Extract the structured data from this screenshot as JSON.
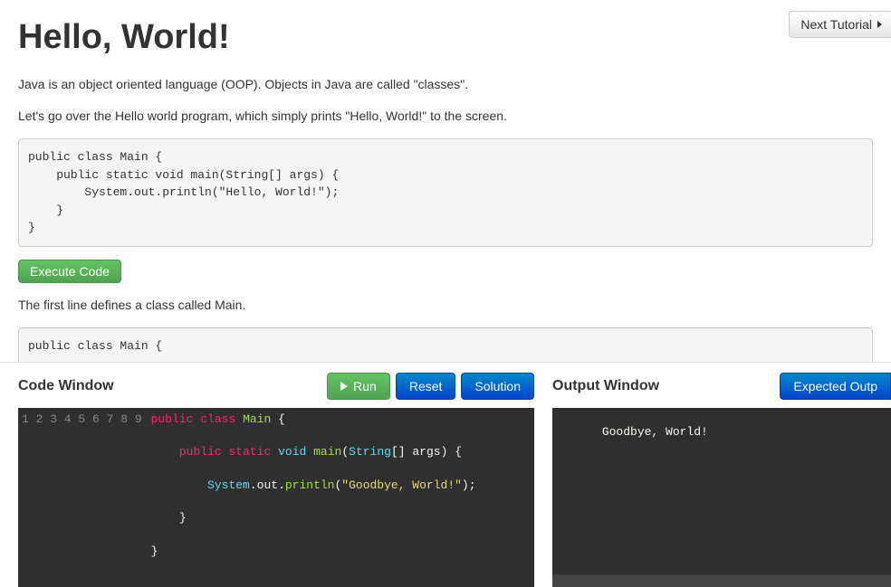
{
  "nav": {
    "next_tutorial_label": "Next Tutorial"
  },
  "page": {
    "title": "Hello, World!",
    "para1": "Java is an object oriented language (OOP). Objects in Java are called \"classes\".",
    "para2": "Let's go over the Hello world program, which simply prints \"Hello, World!\" to the screen.",
    "code_block1": "public class Main {\n    public static void main(String[] args) {\n        System.out.println(\"Hello, World!\");\n    }\n}",
    "execute_label": "Execute Code",
    "para3": "The first line defines a class called Main.",
    "code_block2": "public class Main {"
  },
  "code_panel": {
    "title": "Code Window",
    "run_label": "Run",
    "reset_label": "Reset",
    "solution_label": "Solution",
    "gutter": [
      "1",
      "2",
      "3",
      "4",
      "5",
      "6",
      "7",
      "8",
      "9"
    ],
    "lines": [
      {
        "tokens": [
          {
            "t": "public",
            "c": "kw-red"
          },
          {
            "t": " ",
            "c": "kw-white"
          },
          {
            "t": "class",
            "c": "kw-red"
          },
          {
            "t": " ",
            "c": "kw-white"
          },
          {
            "t": "Main",
            "c": "kw-green"
          },
          {
            "t": " {",
            "c": "kw-white"
          }
        ]
      },
      {
        "tokens": [
          {
            "t": "",
            "c": "kw-white"
          }
        ]
      },
      {
        "tokens": [
          {
            "t": "    ",
            "c": "kw-white"
          },
          {
            "t": "public",
            "c": "kw-red"
          },
          {
            "t": " ",
            "c": "kw-white"
          },
          {
            "t": "static",
            "c": "kw-red"
          },
          {
            "t": " ",
            "c": "kw-white"
          },
          {
            "t": "void",
            "c": "kw-blue"
          },
          {
            "t": " ",
            "c": "kw-white"
          },
          {
            "t": "main",
            "c": "kw-green"
          },
          {
            "t": "(",
            "c": "kw-white"
          },
          {
            "t": "String",
            "c": "kw-blue"
          },
          {
            "t": "[] ",
            "c": "kw-white"
          },
          {
            "t": "args",
            "c": "kw-white"
          },
          {
            "t": ") {",
            "c": "kw-white"
          }
        ]
      },
      {
        "tokens": [
          {
            "t": "",
            "c": "kw-white"
          }
        ]
      },
      {
        "tokens": [
          {
            "t": "        ",
            "c": "kw-white"
          },
          {
            "t": "System",
            "c": "kw-blue"
          },
          {
            "t": ".out.",
            "c": "kw-white"
          },
          {
            "t": "println",
            "c": "kw-green"
          },
          {
            "t": "(",
            "c": "kw-white"
          },
          {
            "t": "\"Goodbye, World!\"",
            "c": "kw-yellow"
          },
          {
            "t": ");",
            "c": "kw-white"
          }
        ]
      },
      {
        "tokens": [
          {
            "t": "",
            "c": "kw-white"
          }
        ]
      },
      {
        "tokens": [
          {
            "t": "    }",
            "c": "kw-white"
          }
        ]
      },
      {
        "tokens": [
          {
            "t": "",
            "c": "kw-white"
          }
        ]
      },
      {
        "tokens": [
          {
            "t": "}",
            "c": "kw-white"
          }
        ]
      }
    ]
  },
  "output_panel": {
    "title": "Output Window",
    "expected_label": "Expected Outp",
    "output_text": "Goodbye, World!"
  }
}
